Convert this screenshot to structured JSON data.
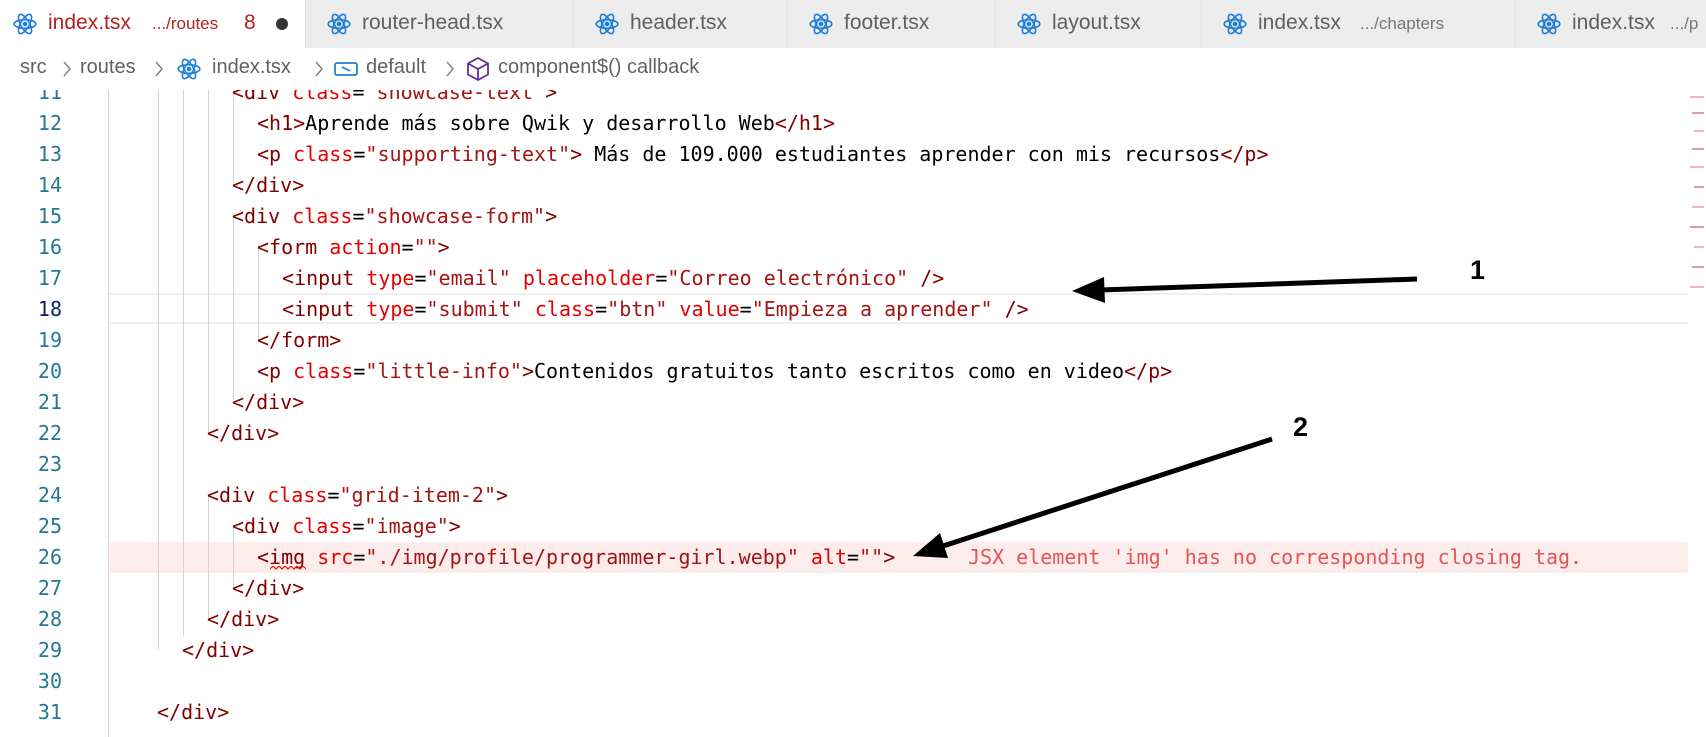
{
  "tabs": [
    {
      "name": "index.tsx",
      "desc": ".../routes",
      "problems": "8",
      "modified": true,
      "active": true
    },
    {
      "name": "router-head.tsx",
      "desc": "",
      "active": false
    },
    {
      "name": "header.tsx",
      "desc": "",
      "active": false
    },
    {
      "name": "footer.tsx",
      "desc": "",
      "active": false
    },
    {
      "name": "layout.tsx",
      "desc": "",
      "active": false
    },
    {
      "name": "index.tsx",
      "desc": ".../chapters",
      "active": false
    },
    {
      "name": "index.tsx",
      "desc": ".../p",
      "active": false
    }
  ],
  "breadcrumb": {
    "items": [
      "src",
      "routes",
      "index.tsx",
      "default",
      "component$() callback"
    ]
  },
  "code": {
    "line_numbers": [
      "11",
      "12",
      "13",
      "14",
      "15",
      "16",
      "17",
      "18",
      "19",
      "20",
      "21",
      "22",
      "23",
      "24",
      "25",
      "26",
      "27",
      "28",
      "29",
      "30",
      "31"
    ],
    "current_line": "18",
    "error_message": "JSX element 'img' has no corresponding closing tag."
  },
  "annotations": {
    "arrow1": "1",
    "arrow2": "2"
  },
  "colors": {
    "tag": "#800000",
    "attr": "#e50000",
    "string": "#a31515",
    "error": "#e55353",
    "line_number": "#237893",
    "react_icon": "#1f7fd6"
  },
  "icons": [
    "react-icon",
    "chevron-right-icon",
    "symbol-variable-icon",
    "symbol-method-icon",
    "modified-dot-icon"
  ]
}
